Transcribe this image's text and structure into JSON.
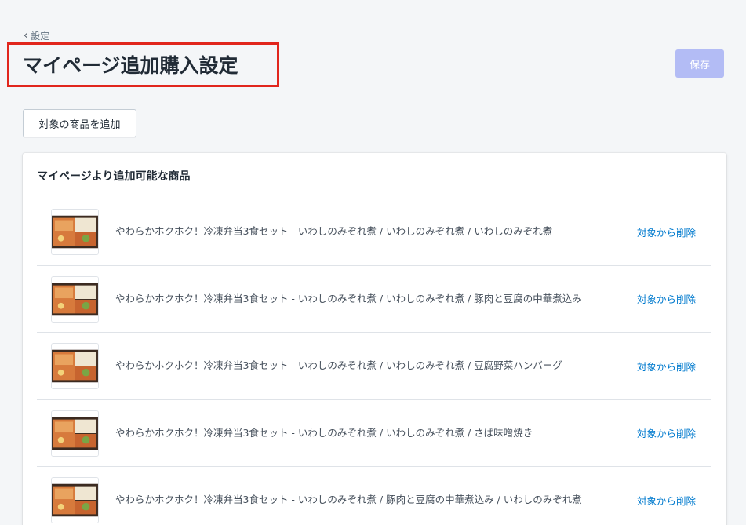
{
  "breadcrumb": {
    "back_label": "設定"
  },
  "header": {
    "title": "マイページ追加購入設定",
    "save_label": "保存"
  },
  "toolbar": {
    "add_label": "対象の商品を追加"
  },
  "card": {
    "title": "マイページより追加可能な商品",
    "items": [
      {
        "name": "やわらかホクホク！冷凍弁当3食セット - いわしのみぞれ煮 / いわしのみぞれ煮 / いわしのみぞれ煮",
        "remove_label": "対象から削除"
      },
      {
        "name": "やわらかホクホク！冷凍弁当3食セット - いわしのみぞれ煮 / いわしのみぞれ煮 / 豚肉と豆腐の中華煮込み",
        "remove_label": "対象から削除"
      },
      {
        "name": "やわらかホクホク！冷凍弁当3食セット - いわしのみぞれ煮 / いわしのみぞれ煮 / 豆腐野菜ハンバーグ",
        "remove_label": "対象から削除"
      },
      {
        "name": "やわらかホクホク！冷凍弁当3食セット - いわしのみぞれ煮 / いわしのみぞれ煮 / さば味噌焼き",
        "remove_label": "対象から削除"
      },
      {
        "name": "やわらかホクホク！冷凍弁当3食セット - いわしのみぞれ煮 / 豚肉と豆腐の中華煮込み / いわしのみぞれ煮",
        "remove_label": "対象から削除"
      }
    ]
  },
  "icons": {
    "back": "chevron-left-icon",
    "thumbnail": "bento-box-image"
  },
  "colors": {
    "title_highlight": "#e1261d",
    "save_disabled": "#b3bcf5",
    "link": "#007ace"
  }
}
